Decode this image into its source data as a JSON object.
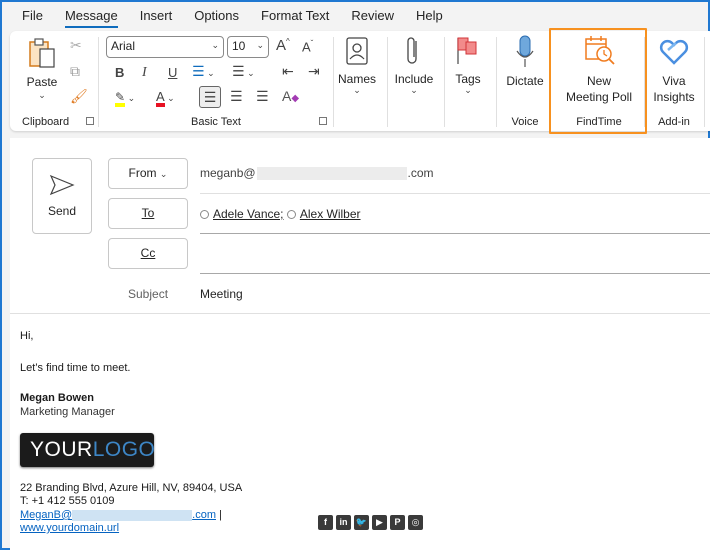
{
  "menu": {
    "tabs": [
      {
        "label": "File",
        "active": false
      },
      {
        "label": "Message",
        "active": true
      },
      {
        "label": "Insert",
        "active": false
      },
      {
        "label": "Options",
        "active": false
      },
      {
        "label": "Format Text",
        "active": false
      },
      {
        "label": "Review",
        "active": false
      },
      {
        "label": "Help",
        "active": false
      }
    ]
  },
  "ribbon": {
    "clipboard": {
      "paste_label": "Paste",
      "group_label": "Clipboard"
    },
    "basic_text": {
      "font_name": "Arial",
      "font_size": "10",
      "group_label": "Basic Text",
      "highlight_color": "#ffff00",
      "font_color": "#e81123"
    },
    "names": {
      "label": "Names"
    },
    "include": {
      "label": "Include"
    },
    "tags": {
      "label": "Tags"
    },
    "voice": {
      "dictate_label": "Dictate",
      "group_label": "Voice"
    },
    "findtime": {
      "button_line1": "New",
      "button_line2": "Meeting Poll",
      "group_label": "FindTime",
      "highlight_color": "#f7911f"
    },
    "addin": {
      "viva_line1": "Viva",
      "viva_line2": "Insights",
      "group_label": "Add-in"
    }
  },
  "compose": {
    "send_label": "Send",
    "from_label": "From",
    "from_value_prefix": "meganb@",
    "from_value_suffix": ".com",
    "to_label": "To",
    "recipients": [
      "Adele Vance;",
      "Alex Wilber"
    ],
    "cc_label": "Cc",
    "subject_label": "Subject",
    "subject_value": "Meeting"
  },
  "body": {
    "greeting": "Hi,",
    "message": "Let’s find time to meet.",
    "signature": {
      "name": "Megan Bowen",
      "title": "Marketing Manager",
      "logo_text_1": "YOUR",
      "logo_text_2": "LOGO",
      "address": "22 Branding Blvd, Azure Hill, NV, 89404, USA",
      "phone": "T: +1 412 555 0109",
      "email_prefix": "MeganB@",
      "email_suffix": ".com",
      "separator": "|",
      "website": "www.yourdomain.url",
      "social": [
        "f",
        "in",
        "t",
        "yt",
        "p",
        "ig"
      ]
    }
  }
}
